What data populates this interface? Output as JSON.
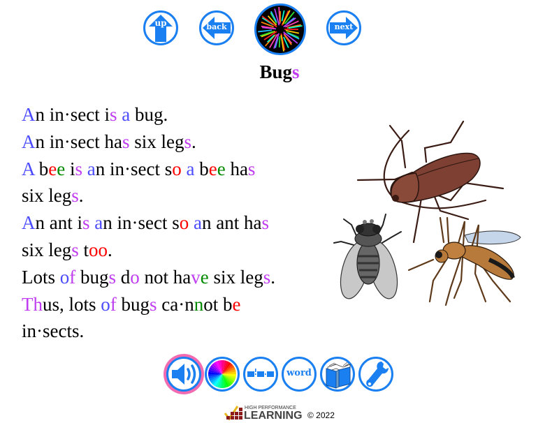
{
  "nav": {
    "up_label": "up",
    "back_label": "back",
    "next_label": "next",
    "hub_icon": "fireworks-icon"
  },
  "title": {
    "segments": [
      {
        "text": "Bug",
        "color": "black"
      },
      {
        "text": "s",
        "color": "purple"
      }
    ]
  },
  "story": {
    "lines": [
      [
        {
          "t": "A",
          "c": "blue"
        },
        {
          "t": "n in·sect i",
          "c": "black"
        },
        {
          "t": "s",
          "c": "purple"
        },
        {
          "t": " ",
          "c": "black"
        },
        {
          "t": "a",
          "c": "blue"
        },
        {
          "t": " bug.",
          "c": "black"
        }
      ],
      [
        {
          "t": "A",
          "c": "blue"
        },
        {
          "t": "n in·sect ha",
          "c": "black"
        },
        {
          "t": "s",
          "c": "purple"
        },
        {
          "t": " six leg",
          "c": "black"
        },
        {
          "t": "s",
          "c": "purple"
        },
        {
          "t": ".",
          "c": "black"
        }
      ],
      [
        {
          "t": "A",
          "c": "blue"
        },
        {
          "t": " b",
          "c": "black"
        },
        {
          "t": "e",
          "c": "red"
        },
        {
          "t": "e",
          "c": "green"
        },
        {
          "t": " i",
          "c": "black"
        },
        {
          "t": "s",
          "c": "purple"
        },
        {
          "t": " ",
          "c": "black"
        },
        {
          "t": "a",
          "c": "blue"
        },
        {
          "t": "n in·sect s",
          "c": "black"
        },
        {
          "t": "o",
          "c": "red"
        },
        {
          "t": " ",
          "c": "black"
        },
        {
          "t": "a",
          "c": "blue"
        },
        {
          "t": " b",
          "c": "black"
        },
        {
          "t": "e",
          "c": "red"
        },
        {
          "t": "e",
          "c": "green"
        },
        {
          "t": " ha",
          "c": "black"
        },
        {
          "t": "s",
          "c": "purple"
        }
      ],
      [
        {
          "t": "six leg",
          "c": "black"
        },
        {
          "t": "s",
          "c": "purple"
        },
        {
          "t": ".",
          "c": "black"
        }
      ],
      [
        {
          "t": "A",
          "c": "blue"
        },
        {
          "t": "n ant i",
          "c": "black"
        },
        {
          "t": "s",
          "c": "purple"
        },
        {
          "t": " ",
          "c": "black"
        },
        {
          "t": "a",
          "c": "blue"
        },
        {
          "t": "n in·sect s",
          "c": "black"
        },
        {
          "t": "o",
          "c": "red"
        },
        {
          "t": " ",
          "c": "black"
        },
        {
          "t": "a",
          "c": "blue"
        },
        {
          "t": "n ant ha",
          "c": "black"
        },
        {
          "t": "s",
          "c": "purple"
        }
      ],
      [
        {
          "t": "six leg",
          "c": "black"
        },
        {
          "t": "s",
          "c": "purple"
        },
        {
          "t": " t",
          "c": "black"
        },
        {
          "t": "oo",
          "c": "red"
        },
        {
          "t": ".",
          "c": "black"
        }
      ],
      [
        {
          "t": "Lots ",
          "c": "black"
        },
        {
          "t": "o",
          "c": "blue"
        },
        {
          "t": "f",
          "c": "purple"
        },
        {
          "t": " bug",
          "c": "black"
        },
        {
          "t": "s",
          "c": "purple"
        },
        {
          "t": " d",
          "c": "black"
        },
        {
          "t": "o",
          "c": "purple"
        },
        {
          "t": " not ha",
          "c": "black"
        },
        {
          "t": "v",
          "c": "purple"
        },
        {
          "t": "e",
          "c": "green"
        },
        {
          "t": " six leg",
          "c": "black"
        },
        {
          "t": "s",
          "c": "purple"
        },
        {
          "t": ".",
          "c": "black"
        }
      ],
      [
        {
          "t": "Th",
          "c": "purple"
        },
        {
          "t": "us, lots ",
          "c": "black"
        },
        {
          "t": "o",
          "c": "blue"
        },
        {
          "t": "f",
          "c": "purple"
        },
        {
          "t": " bug",
          "c": "black"
        },
        {
          "t": "s",
          "c": "purple"
        },
        {
          "t": " ca·n",
          "c": "black"
        },
        {
          "t": "n",
          "c": "green"
        },
        {
          "t": "ot b",
          "c": "black"
        },
        {
          "t": "e",
          "c": "red"
        }
      ],
      [
        {
          "t": "in·sects.",
          "c": "black"
        }
      ]
    ]
  },
  "illustration": {
    "alt": "cockroach, fly and mosquito",
    "items": [
      "cockroach",
      "fly",
      "mosquito"
    ]
  },
  "toolbar": {
    "items": [
      {
        "name": "speaker",
        "label": "",
        "active": true
      },
      {
        "name": "color-wheel",
        "label": ""
      },
      {
        "name": "syllable-split",
        "label": ""
      },
      {
        "name": "word",
        "label": "word"
      },
      {
        "name": "book",
        "label": ""
      },
      {
        "name": "settings-wrench",
        "label": ""
      }
    ]
  },
  "footer": {
    "logo_small": "HIGH PERFORMANCE",
    "logo_big": "LEARNING",
    "copyright": "© 2022"
  },
  "colors": {
    "accent": "#1a7ff0",
    "active_ring": "#f26bb1",
    "blue": "#4b4bff",
    "purple": "#c03cf0",
    "red": "#ff0000",
    "green": "#008a00"
  }
}
